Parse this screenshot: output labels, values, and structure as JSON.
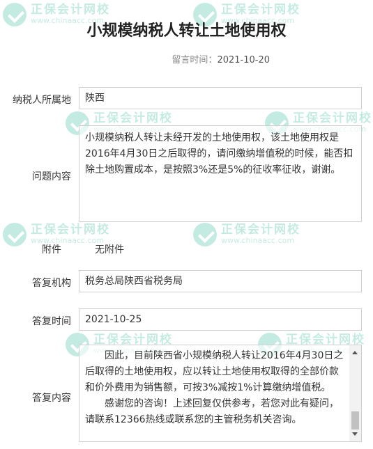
{
  "watermark": {
    "text": "正保会计网校",
    "url": "www.chinaacc.com"
  },
  "page": {
    "title": "小规模纳税人转让土地使用权",
    "message_time_label": "留言时间：",
    "message_time": "2021-10-20"
  },
  "form": {
    "location_label": "纳税人所属地",
    "location_value": "陕西",
    "question_label": "问题内容",
    "question_value": "小规模纳税人转让未经开发的土地使用权，该土地使用权是2016年4月30日之后取得的，请问缴纳增值税的时候，能否扣除土地购置成本，是按照3%还是5%的征收率征收，谢谢。",
    "attachment_label": "附件",
    "attachment_value": "无附件",
    "agency_label": "答复机构",
    "agency_value": "税务总局陕西省税务局",
    "reply_time_label": "答复时间",
    "reply_time_value": "2021-10-25",
    "answer_label": "答复内容",
    "answer_paragraphs": [
      "因此，目前陕西省小规模纳税人转让2016年4月30日之后取得的土地使用权，应以转让土地使用权取得的全部价款和价外费用为销售额，可按3%减按1%计算缴纳增值税。",
      "感谢您的咨询！上述回复仅供参考，若您对此有疑问，请联系12366热线或联系您的主管税务机关咨询。"
    ],
    "answer_scroll_fraction": 0.9
  }
}
